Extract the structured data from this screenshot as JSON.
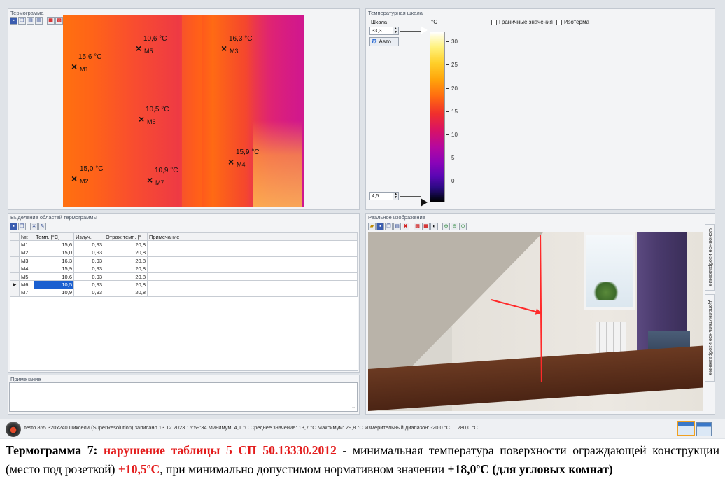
{
  "panels": {
    "thermogram_title": "Термограмма",
    "scale_title": "Температурная шкала",
    "regions_title": "Выделение областей термограммы",
    "note_title": "Примечание",
    "real_image_title": "Реальное изображение"
  },
  "markers": [
    {
      "id": "M1",
      "temp": "15,6 °C"
    },
    {
      "id": "M2",
      "temp": "15,0 °C"
    },
    {
      "id": "M3",
      "temp": "16,3 °C"
    },
    {
      "id": "M4",
      "temp": "15,9 °C"
    },
    {
      "id": "M5",
      "temp": "10,6 °C"
    },
    {
      "id": "M6",
      "temp": "10,5 °C"
    },
    {
      "id": "M7",
      "temp": "10,9 °C"
    }
  ],
  "scale": {
    "label": "Шкала",
    "max_value": "33,3",
    "min_value": "4,5",
    "auto_label": "Авто",
    "unit": "°C",
    "ticks": [
      "30",
      "25",
      "20",
      "15",
      "10",
      "5",
      "0"
    ],
    "limits_label": "Граничные значения",
    "isotherm_label": "Изотерма"
  },
  "table": {
    "headers": [
      "№:",
      "Темп. [°C]",
      "Излуч.",
      "Отраж.темп. [°",
      "Примечание"
    ],
    "rows": [
      [
        "M1",
        "15,6",
        "0,93",
        "20,8",
        ""
      ],
      [
        "M2",
        "15,0",
        "0,93",
        "20,8",
        ""
      ],
      [
        "M3",
        "16,3",
        "0,93",
        "20,8",
        ""
      ],
      [
        "M4",
        "15,9",
        "0,93",
        "20,8",
        ""
      ],
      [
        "M5",
        "10,6",
        "0,93",
        "20,8",
        ""
      ],
      [
        "M6",
        "10,5",
        "0,93",
        "20,8",
        ""
      ],
      [
        "M7",
        "10,9",
        "0,93",
        "20,8",
        ""
      ]
    ],
    "selected_row": 5
  },
  "side_tabs": {
    "main": "Основное изображение",
    "extra": "Дополнительное изображение"
  },
  "status": {
    "text": "testo 865 320x240 Пиксели (SuperResolution) записано 13.12.2023 15:59:34  Минимум: 4,1 °C  Среднее значение: 13,7 °C  Максимум: 29,8 °C  Измерительный диапазон: -20,0 °C ... 280,0 °C"
  },
  "caption": {
    "lead": "Термограмма  7: ",
    "violation": "нарушение таблицы 5 СП 50.13330.2012",
    "text1": " - минимальная температура поверхности ограждающей конструкции (место под розеткой) ",
    "measured": "+10,5ºС",
    "text2": ", при минимально допустимом нормативном значении ",
    "norm": "+18,0ºС (для угловых комнат)"
  },
  "colors": {
    "accent_red": "#e31b1b",
    "selection_blue": "#1a5fd0"
  }
}
